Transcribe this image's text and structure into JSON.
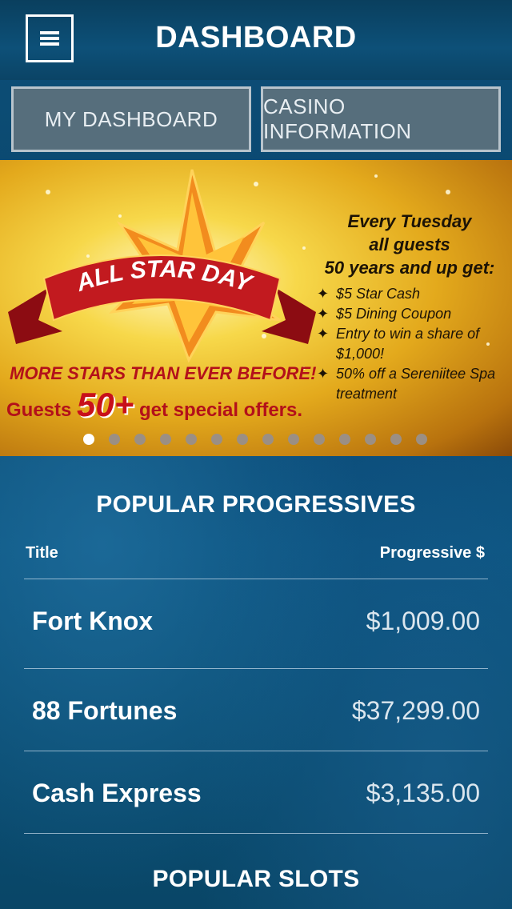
{
  "header": {
    "title": "DASHBOARD",
    "menu_icon": "hamburger-menu-icon"
  },
  "tabs": [
    {
      "label": "MY DASHBOARD"
    },
    {
      "label": "CASINO INFORMATION"
    }
  ],
  "banner": {
    "ribbon": "ALL STAR DAY",
    "headline": [
      "Every Tuesday",
      "all guests",
      "50 years and up get:"
    ],
    "offers": [
      "$5 Star Cash",
      "$5 Dining Coupon",
      "Entry to win a share of $1,000!",
      "50% off a Sereniitee Spa treatment"
    ],
    "tagline1": "MORE STARS THAN EVER BEFORE!",
    "tagline2_pre": "Guests ",
    "tagline2_big": "50+",
    "tagline2_post": " get special offers.",
    "slide_count": 14,
    "active_slide": 1
  },
  "progressives": {
    "title": "POPULAR PROGRESSIVES",
    "col_title": "Title",
    "col_amount": "Progressive $",
    "rows": [
      {
        "name": "Fort Knox",
        "amount": "$1,009.00"
      },
      {
        "name": "88 Fortunes",
        "amount": "$37,299.00"
      },
      {
        "name": "Cash Express",
        "amount": "$3,135.00"
      }
    ]
  },
  "slots": {
    "title": "POPULAR SLOTS"
  },
  "colors": {
    "tab_bg": "#566e7c",
    "banner_red": "#b3101a",
    "accent_white": "#ffffff"
  }
}
